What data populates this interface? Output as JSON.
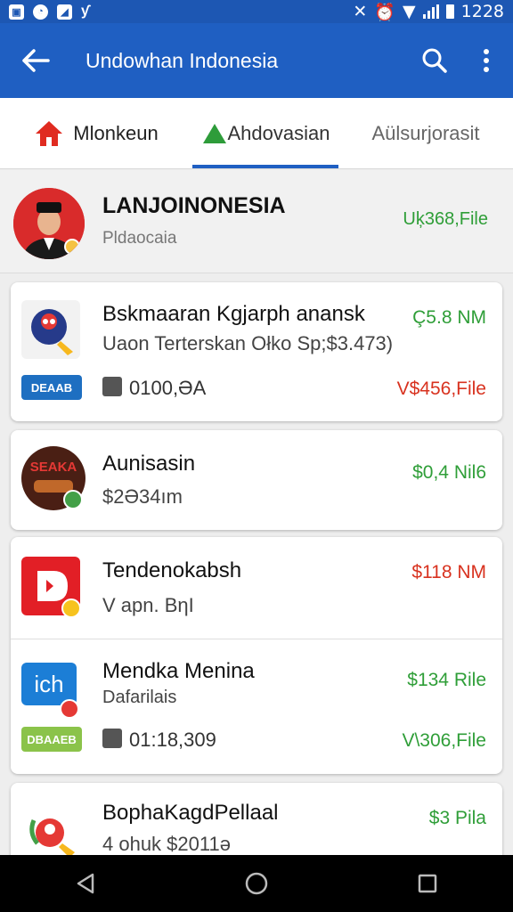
{
  "status_bar": {
    "time": "1228"
  },
  "app_bar": {
    "title": "Undowhan Indonesia"
  },
  "tabs": [
    {
      "label": "Mlonkeun",
      "icon": "home-icon"
    },
    {
      "label": "Ahdovasian",
      "icon": "triangle-icon"
    },
    {
      "label": "Aülsurjorasit"
    }
  ],
  "profile": {
    "name": "LANJOINONESIA",
    "subtitle": "Pldaocaia",
    "amount": "Uķ368,File"
  },
  "transactions": [
    {
      "title": "Bskmaaran Kgjarph anansk",
      "subtitle": "Uaon Terterskan Ołko Sp;$3.473)",
      "amount": "Ç5.8 NM",
      "badge": "DEAAB",
      "wallet_value": "0100,ƏA",
      "secondary_amount": "V$456,File"
    },
    {
      "title": "Aunisasin",
      "subtitle": "$2Ə34ım",
      "amount": "$0,4 Nil6"
    },
    {
      "title": "Tendenokabsh",
      "subtitle": "V apn. BηI",
      "amount": "$118 NM"
    },
    {
      "title": "Mendka Menina",
      "subtitle": "Dafarilais",
      "amount": "$134 Rile",
      "badge": "DBAAEB",
      "wallet_value": "01:18,309",
      "secondary_amount": "V\\306,File"
    },
    {
      "title": "BophaKagdPellaal",
      "subtitle": "4 ohuk $2011ə",
      "amount": "$3 Pila"
    }
  ],
  "icon_texts": {
    "t2": "SEAKA",
    "t4": "ich"
  },
  "colors": {
    "primary": "#1f5fc2",
    "positive": "#2f9e38",
    "negative": "#d8321f"
  }
}
